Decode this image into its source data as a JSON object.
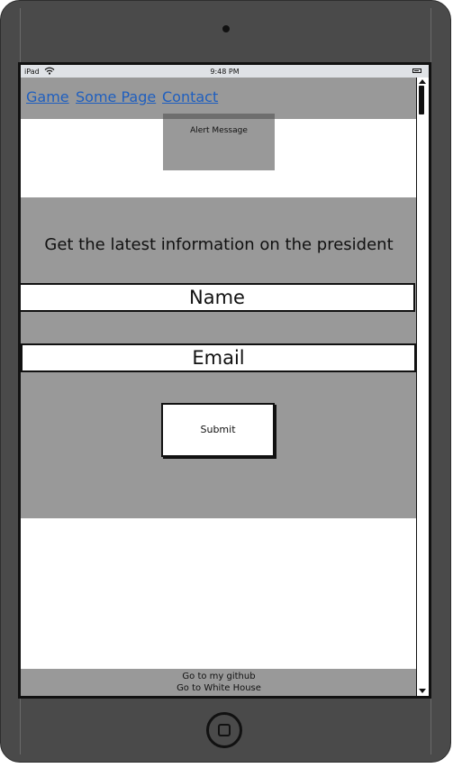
{
  "statusbar": {
    "device": "iPad",
    "time": "9:48 PM"
  },
  "nav": {
    "links": [
      {
        "label": "Game"
      },
      {
        "label": "Some Page"
      },
      {
        "label": "Contact"
      }
    ]
  },
  "alert": {
    "text": "Alert Message"
  },
  "form": {
    "headline": "Get the latest information on the president",
    "name_field": "Name",
    "email_field": "Email",
    "submit_label": "Submit"
  },
  "footer": {
    "links": [
      "Go to my github",
      "Go to White House"
    ]
  },
  "colors": {
    "panel": "#999999",
    "link": "#1f5fbf",
    "device": "#4a4a4a"
  }
}
